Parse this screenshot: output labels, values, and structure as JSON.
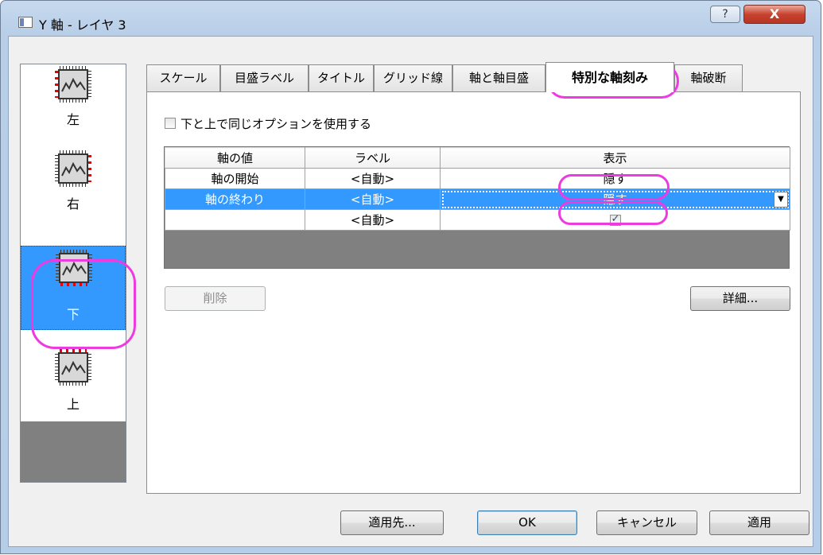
{
  "window": {
    "title": "Y 軸 - レイヤ 3",
    "help_label": "?",
    "close_label": "X"
  },
  "side_list": {
    "items": [
      {
        "label": "左",
        "icon": "axis-left-icon",
        "selected": false
      },
      {
        "label": "右",
        "icon": "axis-right-icon",
        "selected": false
      },
      {
        "label": "下",
        "icon": "axis-bottom-icon",
        "selected": true
      },
      {
        "label": "上",
        "icon": "axis-top-icon",
        "selected": false
      }
    ]
  },
  "tabs": [
    {
      "label": "スケール",
      "active": false
    },
    {
      "label": "目盛ラベル",
      "active": false
    },
    {
      "label": "タイトル",
      "active": false
    },
    {
      "label": "グリッド線",
      "active": false
    },
    {
      "label": "軸と軸目盛",
      "active": false
    },
    {
      "label": "特別な軸刻み",
      "active": true
    },
    {
      "label": "軸破断",
      "active": false
    }
  ],
  "panel": {
    "same_option_label": "下と上で同じオプションを使用する",
    "same_option_checked": false,
    "table": {
      "headers": [
        "軸の値",
        "ラベル",
        "表示"
      ],
      "rows": [
        {
          "axis_value": "軸の開始",
          "label": "<自動>",
          "display": "隠す",
          "selected": false
        },
        {
          "axis_value": "軸の終わり",
          "label": "<自動>",
          "display": "隠す",
          "selected": true
        },
        {
          "axis_value": "",
          "label": "<自動>",
          "display_checked": true,
          "selected": false
        }
      ]
    },
    "delete_label": "削除",
    "details_label": "詳細..."
  },
  "footer": {
    "apply_to_label": "適用先...",
    "ok_label": "OK",
    "cancel_label": "キャンセル",
    "apply_label": "適用"
  },
  "colors": {
    "selection": "#3399ff",
    "highlight": "#ee3be0",
    "close_button": "#c8432f"
  }
}
